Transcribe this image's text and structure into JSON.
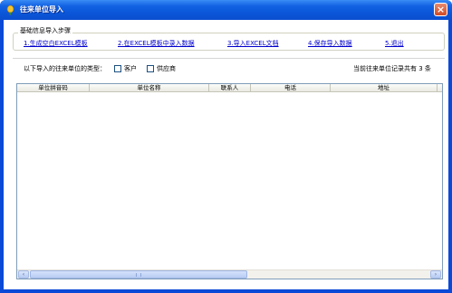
{
  "window": {
    "title": "往来单位导入",
    "close_label": "×"
  },
  "steps_group": {
    "legend": "基础信息导入步骤",
    "steps": [
      "1.生成空白EXCEL模板",
      "2.在EXCEL模板中录入数据",
      "3.导入EXCEL文档",
      "4.保存导入数据",
      "5.退出"
    ]
  },
  "type_section": {
    "label": "以下导入的往来单位的类型：",
    "options": [
      {
        "label": "客户",
        "checked": false
      },
      {
        "label": "供应商",
        "checked": false
      }
    ],
    "record_count_text": "当前往来单位记录共有 3 条"
  },
  "grid": {
    "columns": [
      "单位拼音码",
      "单位名称",
      "联系人",
      "电话",
      "地址"
    ],
    "rows": []
  },
  "scrollbar": {
    "left_arrow": "‹",
    "right_arrow": "›"
  }
}
